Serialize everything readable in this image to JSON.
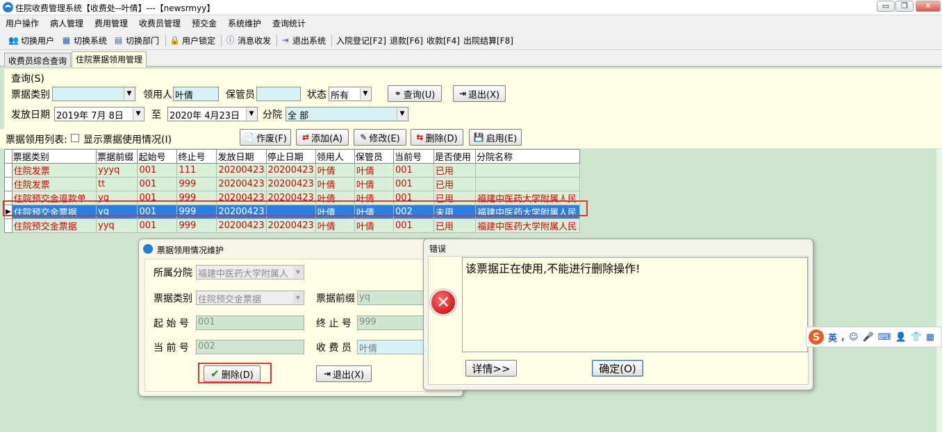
{
  "window": {
    "title": "住院收费管理系统【收费处--叶倩】---【newsrmyy】",
    "controls": [
      "▭",
      "❐",
      "✕"
    ]
  },
  "menubar": [
    "用户操作",
    "病人管理",
    "费用管理",
    "收费员管理",
    "预交金",
    "系统维护",
    "查询统计"
  ],
  "toolbar": {
    "switch_user": "切换用户",
    "switch_system": "切换系统",
    "switch_dept": "切换部门",
    "user_lock": "用户锁定",
    "message": "消息收发",
    "exit": "退出系统",
    "admit": "入院登记[F2]",
    "refund": "退款[F6]",
    "charge": "收款[F4]",
    "discharge": "出院结算[F8]"
  },
  "tabs": [
    "收费员综合查询",
    "住院票据领用管理"
  ],
  "query": {
    "group_label": "查询(S)",
    "bill_type_label": "票据类别",
    "bill_type_value": "",
    "receiver_label": "领用人",
    "receiver_value": "叶倩",
    "keeper_label": "保管员",
    "keeper_value": "",
    "status_label": "状态",
    "status_value": "所有",
    "search_button": "查询(U)",
    "exit_button": "退出(X)",
    "issue_date_label": "发放日期",
    "date_from": "2019年 7月 8日",
    "to_label": "至",
    "date_to": "2020年 4月23日",
    "branch_label": "分院",
    "branch_value": "全 部"
  },
  "list_bar": {
    "label": "票据领用列表:",
    "checkbox_label": "显示票据使用情况(I)",
    "buttons": {
      "void": "作废(F)",
      "add": "添加(A)",
      "edit": "修改(E)",
      "delete": "删除(D)",
      "enable": "启用(E)"
    }
  },
  "grid": {
    "columns": [
      "票据类别",
      "票据前缀",
      "起始号",
      "终止号",
      "发放日期",
      "停止日期",
      "领用人",
      "保管员",
      "当前号",
      "是否使用",
      "分院名称"
    ],
    "rows": [
      [
        "住院发票",
        "yyyq",
        "001",
        "111",
        "20200423",
        "20200423",
        "叶倩",
        "叶倩",
        "001",
        "已用",
        ""
      ],
      [
        "住院发票",
        "tt",
        "001",
        "999",
        "20200423",
        "20200423",
        "叶倩",
        "叶倩",
        "001",
        "已用",
        ""
      ],
      [
        "住院预交金退款单",
        "yq",
        "001",
        "999",
        "20200423",
        "20200423",
        "叶倩",
        "叶倩",
        "001",
        "已用",
        "福建中医药大学附属人民"
      ],
      [
        "住院预交金票据",
        "yq",
        "001",
        "999",
        "20200423",
        "",
        "叶倩",
        "叶倩",
        "002",
        "未用",
        "福建中医药大学附属人民"
      ],
      [
        "住院预交金票据",
        "yyq",
        "001",
        "999",
        "20200423",
        "20200423",
        "叶倩",
        "叶倩",
        "001",
        "已用",
        "福建中医药大学附属人民"
      ]
    ],
    "selected_row": 3
  },
  "edit_dialog": {
    "title": "票据领用情况维护",
    "branch_label": "所属分院",
    "branch_value": "福建中医药大学附属人",
    "bill_type_label": "票据类别",
    "bill_type_value": "住院预交金票据",
    "prefix_label": "票据前缀",
    "prefix_value": "yq",
    "start_label": "起 始 号",
    "start_value": "001",
    "end_label": "终 止 号",
    "end_value": "999",
    "current_label": "当 前 号",
    "current_value": "002",
    "cashier_label": "收 费 员",
    "cashier_value": "叶倩",
    "delete_button": "删除(D)",
    "exit_button": "退出(X)"
  },
  "error_dialog": {
    "title": "错误",
    "message": "该票据正在使用,不能进行删除操作!",
    "details_button": "详情>>",
    "ok_button": "确定(O)"
  },
  "ime": {
    "logo": "S",
    "mode": "英"
  },
  "colors": {
    "background": "#cde6cd",
    "query_panel": "#fffde3",
    "selected_row": "#2c7fe0",
    "row_text": "#d00000",
    "highlight_box": "#e53030"
  }
}
